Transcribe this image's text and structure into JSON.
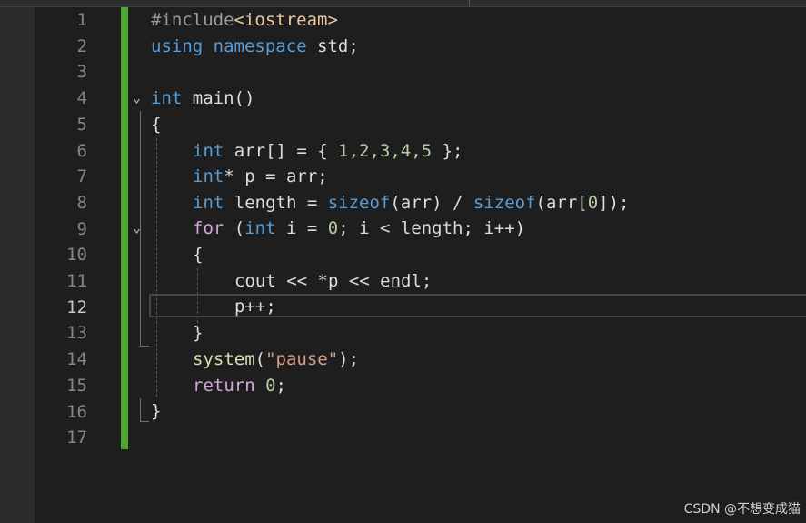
{
  "editor": {
    "active_line": "12",
    "line_numbers": [
      "1",
      "2",
      "3",
      "4",
      "5",
      "6",
      "7",
      "8",
      "9",
      "10",
      "11",
      "12",
      "13",
      "14",
      "15",
      "16",
      "17"
    ],
    "code": {
      "l1_pp": "#include",
      "l1_inc": "<iostream>",
      "l2_using": "using",
      "l2_namespace": "namespace",
      "l2_rest": " std;",
      "l4_int": "int",
      "l4_rest": " main()",
      "l5_brace": "{",
      "l6_int": "int",
      "l6_a": " arr[] = { ",
      "l6_nums": "1,2,3,4,5",
      "l6_b": " };",
      "l7_int": "int",
      "l7_a": "* p = arr;",
      "l8_int": "int",
      "l8_a": " length = ",
      "l8_sizeof1": "sizeof",
      "l8_b": "(arr) / ",
      "l8_sizeof2": "sizeof",
      "l8_c": "(arr[",
      "l8_zero": "0",
      "l8_d": "]);",
      "l9_for": "for",
      "l9_a": " (",
      "l9_int": "int",
      "l9_b": " i = ",
      "l9_zero": "0",
      "l9_c": "; i < length; i++)",
      "l10_brace": "{",
      "l11_text": "cout << *p << endl;",
      "l12_text": "p++;",
      "l13_brace": "}",
      "l14_fn": "system",
      "l14_open": "(",
      "l14_str": "\"pause\"",
      "l14_close": ");",
      "l15_return": "return",
      "l15_sp": " ",
      "l15_zero": "0",
      "l15_semi": ";",
      "l16_brace": "}"
    }
  },
  "watermark": "CSDN @不想变成猫",
  "colors": {
    "background": "#1e1e1e",
    "change_bar": "#4ea72e",
    "keyword": "#569cd6",
    "control": "#d8a0df",
    "number": "#b5cea8",
    "string": "#d69d85"
  }
}
